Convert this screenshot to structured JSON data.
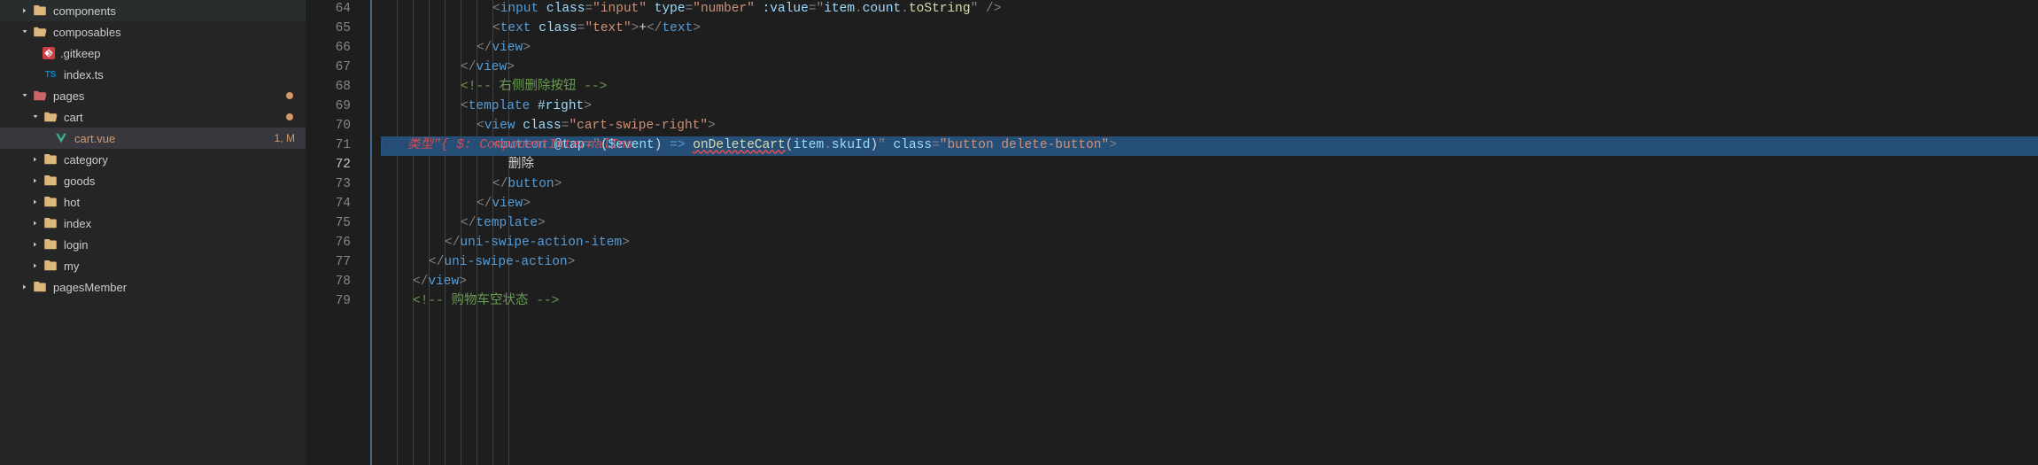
{
  "sidebar": {
    "items": [
      {
        "label": "components",
        "type": "folder",
        "depth": 1,
        "expanded": false,
        "chevron": true
      },
      {
        "label": "composables",
        "type": "folder",
        "depth": 1,
        "expanded": true,
        "chevron": true
      },
      {
        "label": ".gitkeep",
        "type": "git",
        "depth": 2,
        "chevron": false
      },
      {
        "label": "index.ts",
        "type": "ts",
        "depth": 2,
        "chevron": false
      },
      {
        "label": "pages",
        "type": "folder-special",
        "depth": 1,
        "expanded": true,
        "chevron": true,
        "dot": true
      },
      {
        "label": "cart",
        "type": "folder",
        "depth": 2,
        "expanded": true,
        "chevron": true,
        "dot": true
      },
      {
        "label": "cart.vue",
        "type": "vue",
        "depth": 3,
        "chevron": false,
        "active": true,
        "badge": "1, M",
        "dim": true
      },
      {
        "label": "category",
        "type": "folder",
        "depth": 2,
        "expanded": false,
        "chevron": true
      },
      {
        "label": "goods",
        "type": "folder",
        "depth": 2,
        "expanded": false,
        "chevron": true
      },
      {
        "label": "hot",
        "type": "folder",
        "depth": 2,
        "expanded": false,
        "chevron": true
      },
      {
        "label": "index",
        "type": "folder",
        "depth": 2,
        "expanded": false,
        "chevron": true
      },
      {
        "label": "login",
        "type": "folder",
        "depth": 2,
        "expanded": false,
        "chevron": true
      },
      {
        "label": "my",
        "type": "folder",
        "depth": 2,
        "expanded": false,
        "chevron": true
      },
      {
        "label": "pagesMember",
        "type": "folder",
        "depth": 1,
        "expanded": false,
        "chevron": true
      }
    ]
  },
  "editor": {
    "firstLine": 64,
    "currentLine": 72,
    "errorLine": 71,
    "errorInline": "类型\"{ $: ComponentInternalIns",
    "lines": {
      "64": {
        "indent": 7,
        "html": "<span class='t-punc'>&lt;</span><span class='t-tag'>input</span> <span class='t-attr'>class</span><span class='t-punc'>=</span><span class='t-str'>\"input\"</span> <span class='t-attr'>type</span><span class='t-punc'>=</span><span class='t-str'>\"number\"</span> <span class='t-attr'>:value</span><span class='t-punc'>=</span><span class='t-punc'>\"</span><span class='t-var'>item</span><span class='t-punc'>.</span><span class='t-var'>count</span><span class='t-punc'>.</span><span class='t-fn'>toString</span><span class='t-punc'>\"</span> <span class='t-punc'>/&gt;</span>"
      },
      "65": {
        "indent": 7,
        "html": "<span class='t-punc'>&lt;</span><span class='t-tag'>text</span> <span class='t-attr'>class</span><span class='t-punc'>=</span><span class='t-str'>\"text\"</span><span class='t-punc'>&gt;</span><span class='t-txt'>+</span><span class='t-punc'>&lt;/</span><span class='t-tag'>text</span><span class='t-punc'>&gt;</span>"
      },
      "66": {
        "indent": 6,
        "html": "<span class='t-punc'>&lt;/</span><span class='t-tag'>view</span><span class='t-punc'>&gt;</span>"
      },
      "67": {
        "indent": 5,
        "html": "<span class='t-punc'>&lt;/</span><span class='t-tag'>view</span><span class='t-punc'>&gt;</span>"
      },
      "68": {
        "indent": 5,
        "html": "<span class='t-comment'>&lt;!-- 右侧删除按钮 --&gt;</span>"
      },
      "69": {
        "indent": 5,
        "html": "<span class='t-punc'>&lt;</span><span class='t-tag'>template</span> <span class='t-attr'>#right</span><span class='t-punc'>&gt;</span>"
      },
      "70": {
        "indent": 6,
        "html": "<span class='t-punc'>&lt;</span><span class='t-tag'>view</span> <span class='t-attr'>class</span><span class='t-punc'>=</span><span class='t-str'>\"cart-swipe-right\"</span><span class='t-punc'>&gt;</span>"
      },
      "71": {
        "indent": 7,
        "html": "<span class='t-punc'>&lt;</span><span class='t-tag'>button</span> <span class='t-attr'>@tap</span><span class='t-punc'>=</span><span class='t-punc'>\"</span><span class='t-paren'>(</span><span class='t-var'>$event</span><span class='t-paren'>)</span> <span class='t-tag'>=&gt;</span> <span class='t-fn squiggle'>onDeleteCart</span><span class='t-paren'>(</span><span class='t-var'>item</span><span class='t-punc'>.</span><span class='t-var'>skuId</span><span class='t-paren'>)</span><span class='t-punc'>\"</span> <span class='t-attr'>class</span><span class='t-punc'>=</span><span class='t-str'>\"button delete-button\"</span><span class='t-punc'>&gt;</span>",
        "highlight": true,
        "dots": true
      },
      "72": {
        "indent": 8,
        "html": "<span class='t-txt'>删除</span>"
      },
      "73": {
        "indent": 7,
        "html": "<span class='t-punc'>&lt;/</span><span class='t-tag'>button</span><span class='t-punc'>&gt;</span>"
      },
      "74": {
        "indent": 6,
        "html": "<span class='t-punc'>&lt;/</span><span class='t-tag'>view</span><span class='t-punc'>&gt;</span>"
      },
      "75": {
        "indent": 5,
        "html": "<span class='t-punc'>&lt;/</span><span class='t-tag'>template</span><span class='t-punc'>&gt;</span>"
      },
      "76": {
        "indent": 4,
        "html": "<span class='t-punc'>&lt;/</span><span class='t-tag'>uni-swipe-action-item</span><span class='t-punc'>&gt;</span>"
      },
      "77": {
        "indent": 3,
        "html": "<span class='t-punc'>&lt;/</span><span class='t-tag'>uni-swipe-action</span><span class='t-punc'>&gt;</span>"
      },
      "78": {
        "indent": 2,
        "html": "<span class='t-punc'>&lt;/</span><span class='t-tag'>view</span><span class='t-punc'>&gt;</span>"
      },
      "79": {
        "indent": 2,
        "html": "<span class='t-comment'>&lt;!-- 购物车空状态 --&gt;</span>"
      }
    }
  }
}
